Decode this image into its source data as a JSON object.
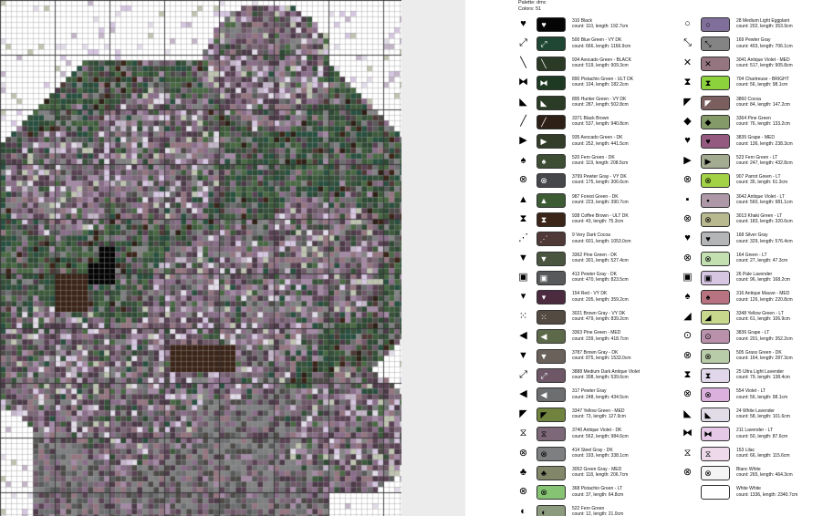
{
  "legend": {
    "palette_label": "Palette: dmc",
    "colors_label": "Colors: 51"
  },
  "colors": {
    "viewer_background": "#5f5f5f",
    "page": "#ffffff",
    "grid_line": "#9a9a9a"
  },
  "entries_left": [
    {
      "symbol": "♥",
      "name": "310 Black",
      "stats": "count: 110, length: 192.7cm",
      "color": "#050505"
    },
    {
      "symbol": "⤢",
      "name": "500 Blue Green - VY DK",
      "stats": "count: 666, length: 1166.9cm",
      "color": "#1f4733"
    },
    {
      "symbol": "╲",
      "name": "934 Avocado Green - BLACK",
      "stats": "count: 519, length: 909.3cm",
      "color": "#2b3a25"
    },
    {
      "symbol": "⧓",
      "name": "890 Pistachio Green - ULT DK",
      "stats": "count: 104, length: 182.2cm",
      "color": "#1e3a22"
    },
    {
      "symbol": "◣",
      "name": "895 Hunter Green - VY DK",
      "stats": "count: 287, length: 502.8cm",
      "color": "#2a3c26"
    },
    {
      "symbol": "╱",
      "name": "3371 Black Brown",
      "stats": "count: 537, length: 940.8cm",
      "color": "#2e2016"
    },
    {
      "symbol": "▶",
      "name": "935 Avocado Green - DK",
      "stats": "count: 252, length: 441.5cm",
      "color": "#343d29"
    },
    {
      "symbol": "♠",
      "name": "520 Fern Green - DK",
      "stats": "count: 119, length: 208.5cm",
      "color": "#3e4e35"
    },
    {
      "symbol": "⊗",
      "name": "3799 Pewter Gray - VY DK",
      "stats": "count: 175, length: 306.6cm",
      "color": "#45474a"
    },
    {
      "symbol": "▲",
      "name": "987 Forest Green - DK",
      "stats": "count: 223, length: 390.7cm",
      "color": "#3d5c34"
    },
    {
      "symbol": "⧗",
      "name": "938 Coffee Brown - ULT DK",
      "stats": "count: 43, length: 75.3cm",
      "color": "#3b2418"
    },
    {
      "symbol": "⋰",
      "name": "9 Very Dark Cocoa",
      "stats": "count: 601, length: 1053.0cm",
      "color": "#4f3a38"
    },
    {
      "symbol": "▼",
      "name": "3362 Pine Green - DK",
      "stats": "count: 301, length: 527.4cm",
      "color": "#4a5540"
    },
    {
      "symbol": "▣",
      "name": "413 Pewter Gray - DK",
      "stats": "count: 470, length: 823.5cm",
      "color": "#57595a"
    },
    {
      "symbol": "▾",
      "name": "154 Red - VY DK",
      "stats": "count: 205, length: 359.2cm",
      "color": "#4c2a40"
    },
    {
      "symbol": "⁙",
      "name": "3021 Brown Gray - VY DK",
      "stats": "count: 479, length: 839.2cm",
      "color": "#534a42"
    },
    {
      "symbol": "◀",
      "name": "3363 Pine Green - MED",
      "stats": "count: 239, length: 418.7cm",
      "color": "#5d6a4a"
    },
    {
      "symbol": "▼",
      "name": "3787 Brown Gray - DK",
      "stats": "count: 875, length: 1533.0cm",
      "color": "#6a625a"
    },
    {
      "symbol": "⤢",
      "name": "3888 Medium Dark Antique Violet",
      "stats": "count: 308, length: 539.6cm",
      "color": "#6e5868"
    },
    {
      "symbol": "◀",
      "name": "317 Pewter Gray",
      "stats": "count: 248, length: 434.5cm",
      "color": "#6d6e70"
    },
    {
      "symbol": "◤",
      "name": "3347 Yellow Green - MED",
      "stats": "count: 73, length: 127.9cm",
      "color": "#71843f"
    },
    {
      "symbol": "⧖",
      "name": "3740 Antique Violet - DK",
      "stats": "count: 562, length: 984.6cm",
      "color": "#7c6878"
    },
    {
      "symbol": "⊗",
      "name": "414 Steel Gray - DK",
      "stats": "count: 193, length: 338.1cm",
      "color": "#7e7f80"
    },
    {
      "symbol": "♣",
      "name": "3052 Green Gray - MED",
      "stats": "count: 118, length: 206.7cm",
      "color": "#82876a"
    },
    {
      "symbol": "⊗",
      "name": "368 Pistachio Green - LT",
      "stats": "count: 37, length: 64.8cm",
      "color": "#86c373"
    },
    {
      "symbol": "◐",
      "name": "522 Fern Green",
      "stats": "count: 12, length: 21.0cm",
      "color": "#8c9a7e"
    }
  ],
  "entries_right": [
    {
      "symbol": "○",
      "name": "28 Medium Light Eggplant",
      "stats": "count: 202, length: 353.9cm",
      "color": "#7f6f9a"
    },
    {
      "symbol": "⤡",
      "name": "169 Pewter Gray",
      "stats": "count: 403, length: 706.1cm",
      "color": "#848484"
    },
    {
      "symbol": "✕",
      "name": "3041 Antique Violet - MED",
      "stats": "count: 517, length: 905.8cm",
      "color": "#957580"
    },
    {
      "symbol": "⧗",
      "name": "704 Chartreuse - BRIGHT",
      "stats": "count: 56, length: 98.1cm",
      "color": "#8cd23c"
    },
    {
      "symbol": "◤",
      "name": "3860 Cocoa",
      "stats": "count: 84, length: 147.2cm",
      "color": "#7b5f5f"
    },
    {
      "symbol": "◆",
      "name": "3364 Pine Green",
      "stats": "count: 76, length: 133.2cm",
      "color": "#849a69"
    },
    {
      "symbol": "♥",
      "name": "3835 Grape - MED",
      "stats": "count: 136, length: 238.3cm",
      "color": "#945a80"
    },
    {
      "symbol": "▶",
      "name": "523 Fern Green - LT",
      "stats": "count: 247, length: 432.8cm",
      "color": "#a3ab90"
    },
    {
      "symbol": "⊗",
      "name": "907 Parrot Green - LT",
      "stats": "count: 35, length: 61.3cm",
      "color": "#a4d246"
    },
    {
      "symbol": "▪",
      "name": "3042 Antique Violet - LT",
      "stats": "count: 560, length: 981.1cm",
      "color": "#ae97a6"
    },
    {
      "symbol": "⊗",
      "name": "3013 Khaki Green - LT",
      "stats": "count: 183, length: 320.6cm",
      "color": "#b9b98f"
    },
    {
      "symbol": "♥",
      "name": "168 Silver Gray",
      "stats": "count: 329, length: 576.4cm",
      "color": "#b3b5b6"
    },
    {
      "symbol": "⊗",
      "name": "164 Green - LT",
      "stats": "count: 27, length: 47.3cm",
      "color": "#c3e0b0"
    },
    {
      "symbol": "▣",
      "name": "26 Pale Lavender",
      "stats": "count: 96, length: 168.2cm",
      "color": "#d6c6e2"
    },
    {
      "symbol": "♠",
      "name": "316 Antique Mauve - MED",
      "stats": "count: 126, length: 220.8cm",
      "color": "#b7737f"
    },
    {
      "symbol": "◢",
      "name": "3348 Yellow Green - LT",
      "stats": "count: 61, length: 106.9cm",
      "color": "#c8d98e"
    },
    {
      "symbol": "⊙",
      "name": "3836 Grape - LT",
      "stats": "count: 201, length: 352.2cm",
      "color": "#ba91aa"
    },
    {
      "symbol": "⊗",
      "name": "505 Grass Green - DK",
      "stats": "count: 164, length: 287.3cm",
      "color": "#b9cca9"
    },
    {
      "symbol": "⧗",
      "name": "25 Ultra Light Lavender",
      "stats": "count: 79, length: 138.4cm",
      "color": "#e0d7ea"
    },
    {
      "symbol": "⊗",
      "name": "554 Violet - LT",
      "stats": "count: 56, length: 98.1cm",
      "color": "#dbb0dd"
    },
    {
      "symbol": "◣",
      "name": "24 White Lavender",
      "stats": "count: 58, length: 101.6cm",
      "color": "#e2dce8"
    },
    {
      "symbol": "⧓",
      "name": "211 Lavender - LT",
      "stats": "count: 50, length: 87.6cm",
      "color": "#e4c8e6"
    },
    {
      "symbol": "⧖",
      "name": "153 Lilac",
      "stats": "count: 66, length: 115.6cm",
      "color": "#eed9ea"
    },
    {
      "symbol": "⊗",
      "name": "Blanc White",
      "stats": "count: 265, length: 464.3cm",
      "color": "#f4f4f4"
    },
    {
      "symbol": "",
      "name": "White White",
      "stats": "count: 1336, length: 2340.7cm",
      "color": "#ffffff"
    }
  ]
}
